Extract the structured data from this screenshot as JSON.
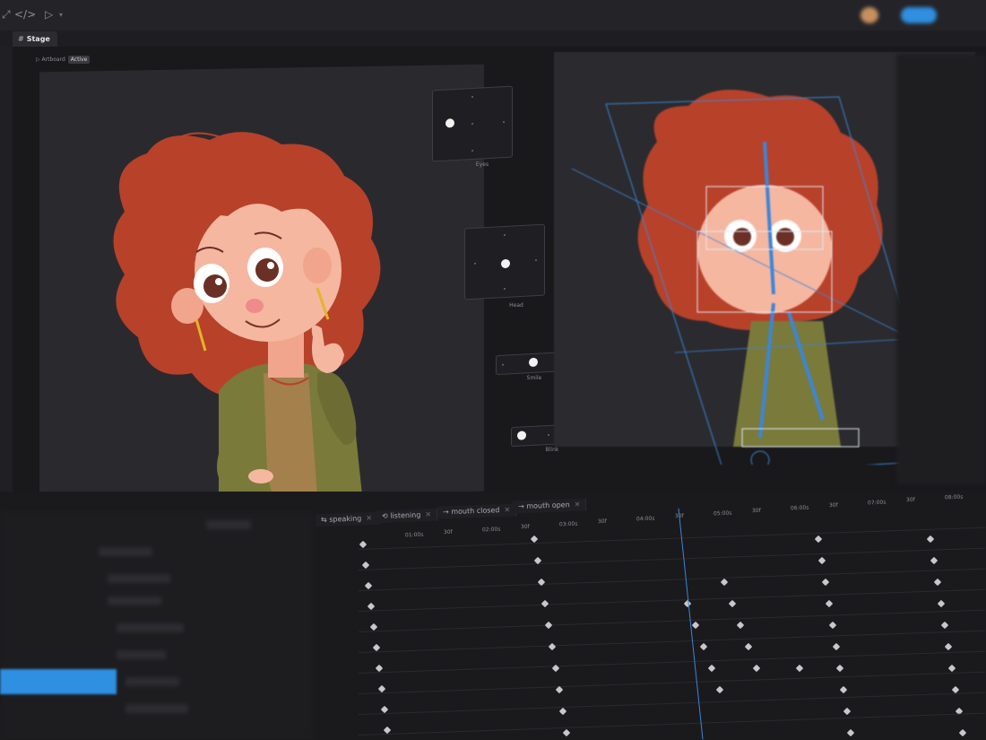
{
  "toolbar": {
    "code_icon": "</>",
    "play_icon": "▷",
    "chevron": "▾",
    "accent": "#3a86d9"
  },
  "stage": {
    "tab_label": "Stage",
    "tab_icon": "#",
    "artboard_label": "Artboard",
    "artboard_status": "Active"
  },
  "controllers": [
    {
      "label": "Eyes"
    },
    {
      "label": "Head"
    },
    {
      "label": "Smile"
    },
    {
      "label": "Blink"
    }
  ],
  "timeline": {
    "tabs": [
      {
        "label": "speaking",
        "icon": "⇆"
      },
      {
        "label": "listening",
        "icon": "⟲"
      },
      {
        "label": "mouth closed",
        "icon": "→"
      },
      {
        "label": "mouth open",
        "icon": "→"
      }
    ],
    "close_icon": "✕",
    "ruler": [
      "01:00s",
      "30f",
      "02:00s",
      "30f",
      "03:00s",
      "30f",
      "04:00s",
      "30f",
      "05:00s",
      "30f",
      "06:00s",
      "30f",
      "07:00s",
      "30f",
      "08:00s"
    ]
  },
  "colors": {
    "hair": "#b8412a",
    "skin": "#f5b7a0",
    "cardigan": "#7a7a3a",
    "rig": "#3a86d9"
  }
}
